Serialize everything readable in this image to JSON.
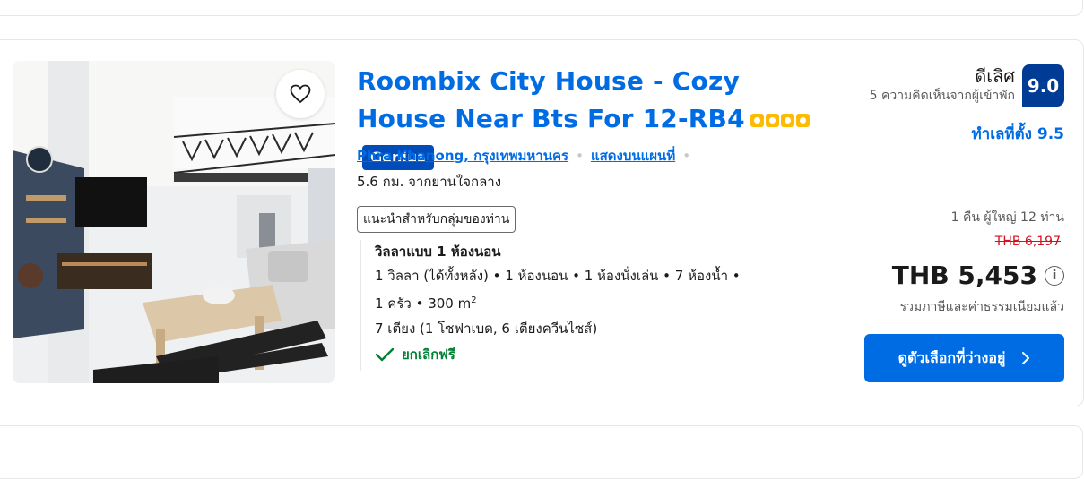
{
  "listing": {
    "title": "Roombix City House - Cozy House Near Bts For 12-RB4",
    "stars": 4,
    "genius_label": "Genius",
    "location": "Phra Khanong, กรุงเทพมหานคร",
    "map_link": "แสดงบนแผนที่",
    "distance": "5.6 กม. จากย่านใจกลาง",
    "recommend_badge": "แนะนำสำหรับกลุ่มของท่าน",
    "room_name": "วิลลาแบบ 1 ห้องนอน",
    "room_line1": "1 วิลลา (ได้ทั้งหลัง) • 1 ห้องนอน • 1 ห้องนั่งเล่น • 7 ห้องน้ำ •",
    "room_line2_prefix": "1 ครัว • 300 m",
    "room_line2_sup": "2",
    "room_line3": "7 เตียง (1 โซฟาเบด, 6 เตียงควีนไซส์)",
    "free_cancel": "ยกเลิกฟรี"
  },
  "rating": {
    "word": "ดีเลิศ",
    "count": "5 ความคิดเห็นจากผู้เข้าพัก",
    "score": "9.0",
    "location_score": "ทำเลที่ตั้ง 9.5"
  },
  "pricing": {
    "nights": "1 คืน ผู้ใหญ่ 12 ท่าน",
    "old_price": "THB 6,197",
    "price": "THB 5,453",
    "tax_note": "รวมภาษีและค่าธรรมเนียมแล้ว",
    "cta": "ดูตัวเลือกที่ว่างอยู่"
  },
  "colors": {
    "link_blue": "#006ce4",
    "score_blue": "#003b95",
    "genius_blue": "#004cb8",
    "star_yellow": "#febb02",
    "strike_red": "#d4111e",
    "green": "#008234"
  }
}
